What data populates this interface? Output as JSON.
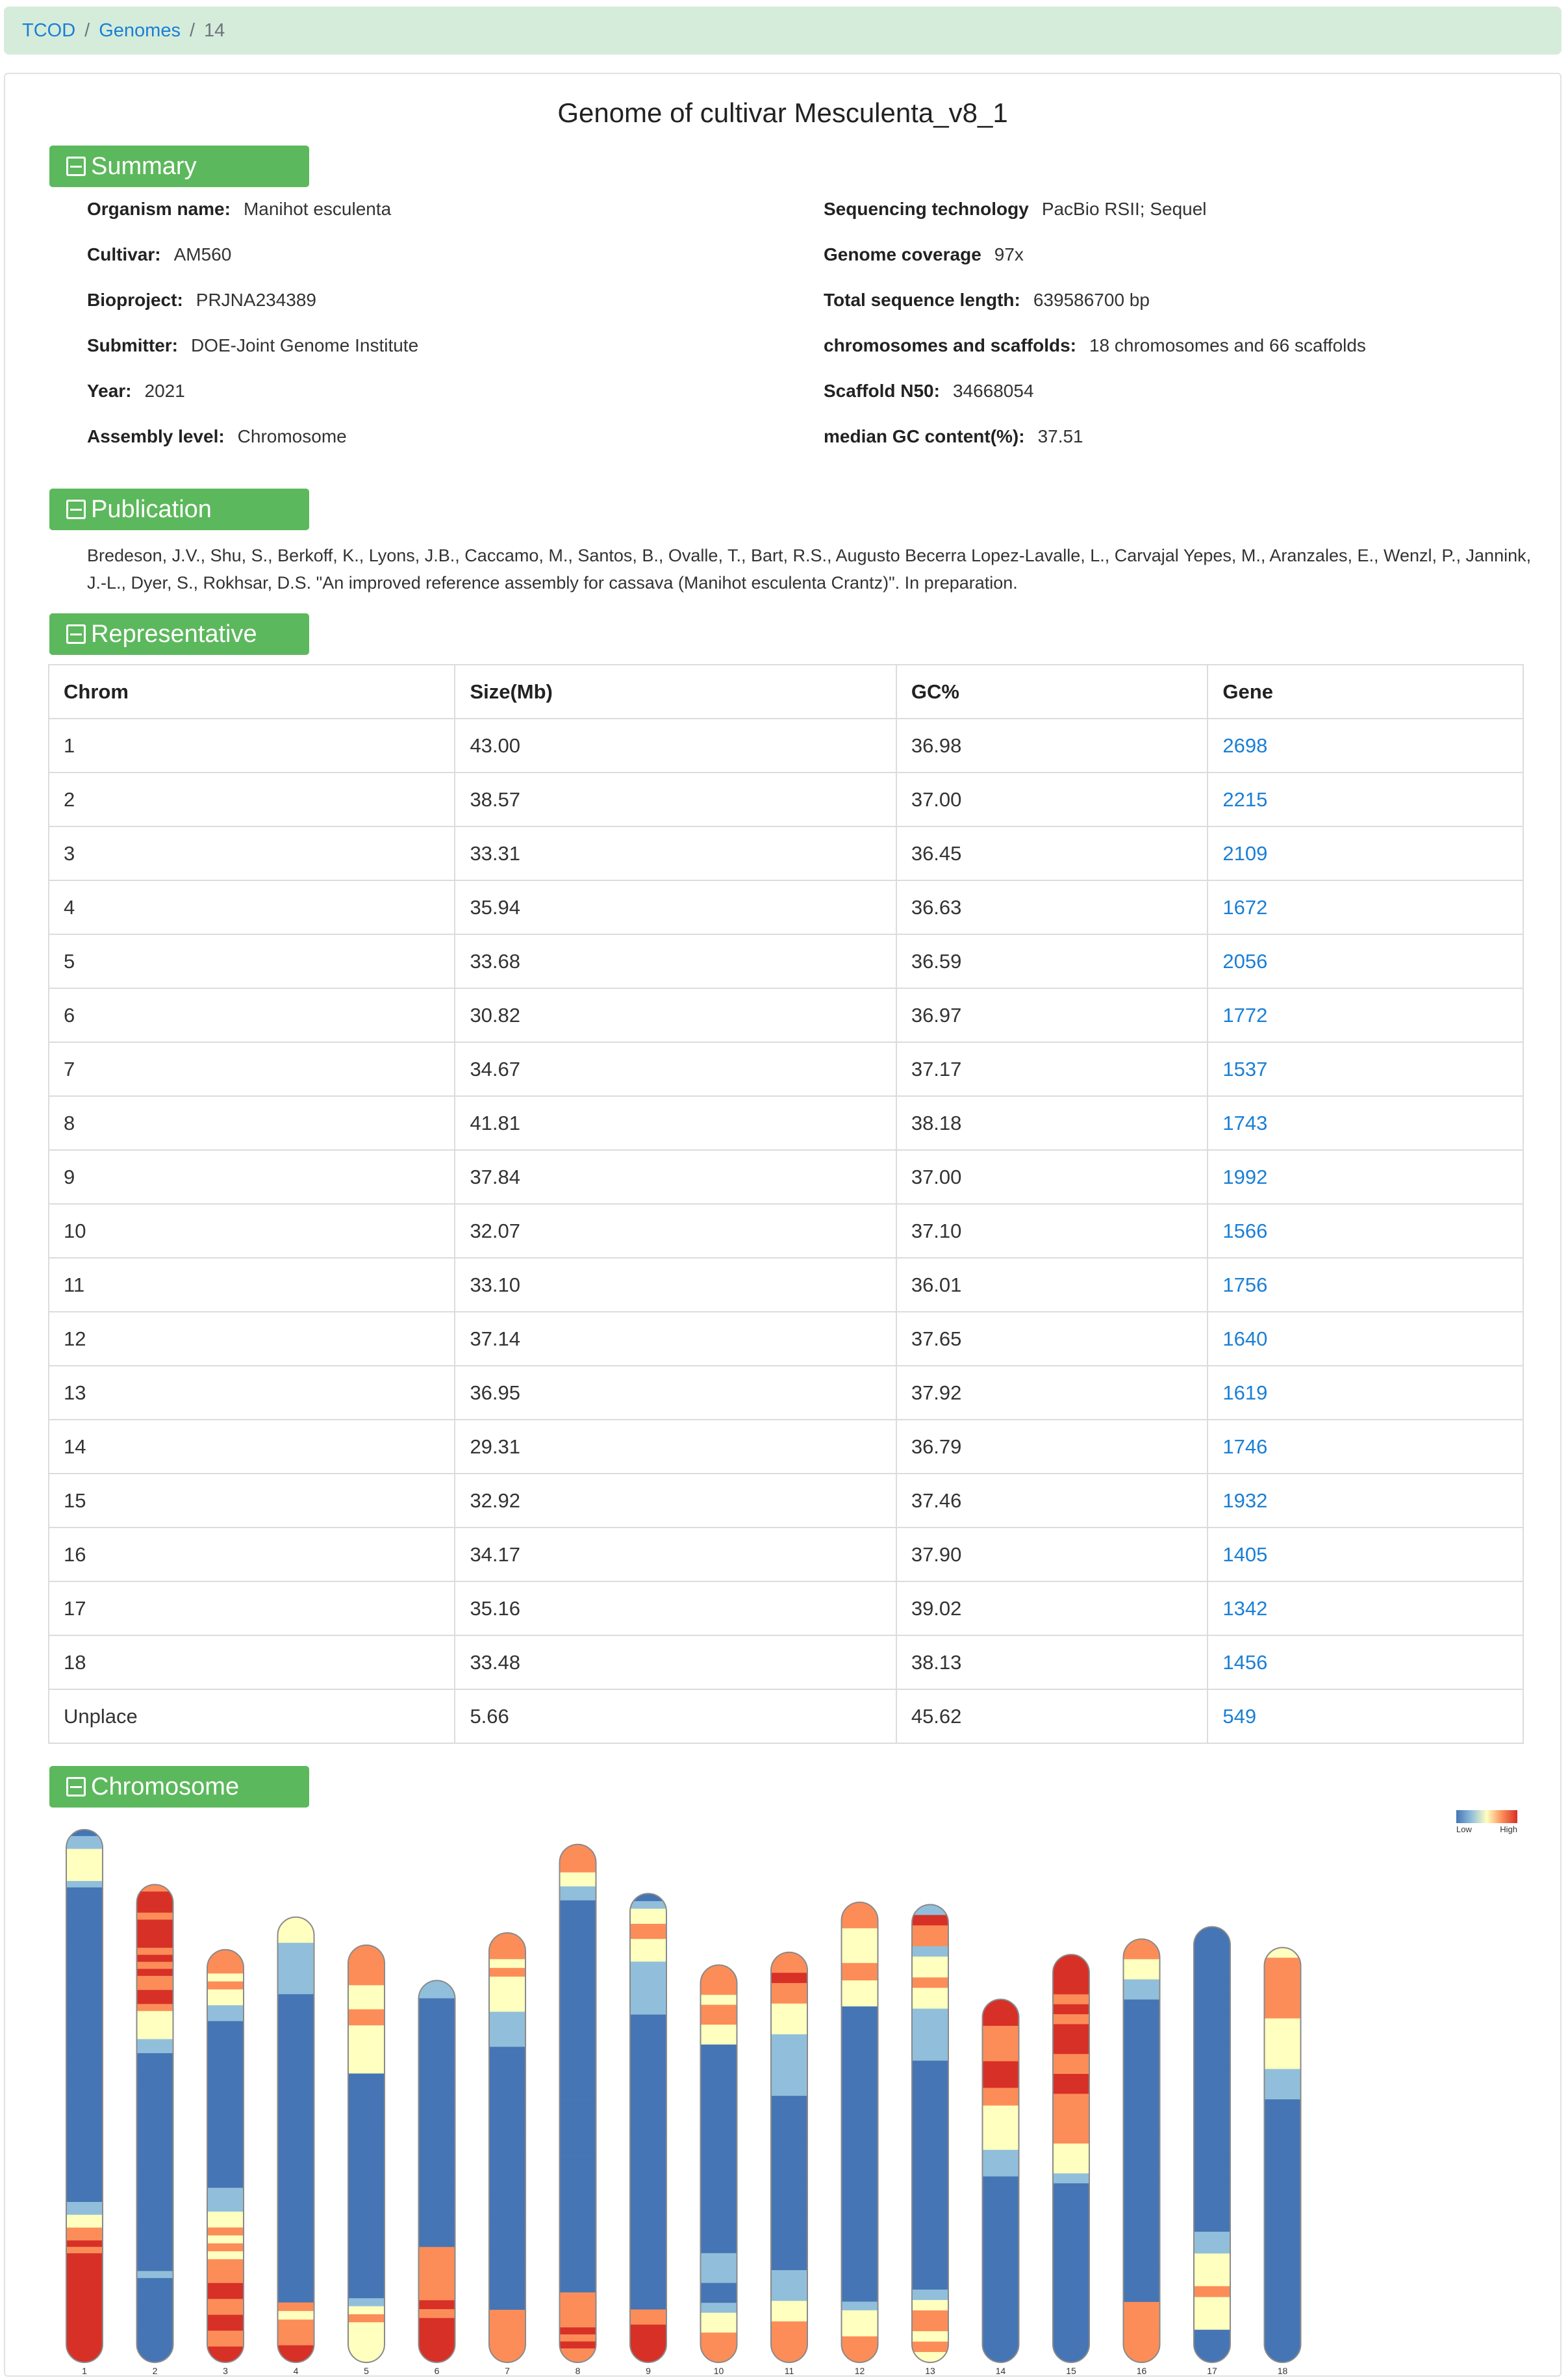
{
  "breadcrumb": {
    "home": "TCOD",
    "genomes": "Genomes",
    "current": "14"
  },
  "title": "Genome of cultivar Mesculenta_v8_1",
  "summary": {
    "heading": "Summary",
    "left": [
      {
        "label": "Organism name:",
        "value": "Manihot esculenta"
      },
      {
        "label": "Cultivar:",
        "value": "AM560"
      },
      {
        "label": "Bioproject:",
        "value": "PRJNA234389"
      },
      {
        "label": "Submitter:",
        "value": "DOE-Joint Genome Institute"
      },
      {
        "label": "Year:",
        "value": "2021"
      },
      {
        "label": "Assembly level:",
        "value": "Chromosome"
      }
    ],
    "right": [
      {
        "label": "Sequencing technology",
        "value": "PacBio RSII; Sequel"
      },
      {
        "label": "Genome coverage",
        "value": "97x"
      },
      {
        "label": "Total sequence length:",
        "value": "639586700 bp"
      },
      {
        "label": "chromosomes and scaffolds:",
        "value": "18 chromosomes and 66 scaffolds"
      },
      {
        "label": "Scaffold N50:",
        "value": "34668054"
      },
      {
        "label": "median GC content(%):",
        "value": "37.51"
      }
    ]
  },
  "publication": {
    "heading": "Publication",
    "text": "Bredeson, J.V., Shu, S., Berkoff, K., Lyons, J.B., Caccamo, M., Santos, B., Ovalle, T., Bart, R.S., Augusto Becerra Lopez-Lavalle, L., Carvajal Yepes, M., Aranzales, E., Wenzl, P., Jannink, J.-L., Dyer, S., Rokhsar, D.S. \"An improved reference assembly for cassava (Manihot esculenta Crantz)\". In preparation."
  },
  "representative": {
    "heading": "Representative",
    "columns": [
      "Chrom",
      "Size(Mb)",
      "GC%",
      "Gene"
    ],
    "rows": [
      [
        "1",
        "43.00",
        "36.98",
        "2698"
      ],
      [
        "2",
        "38.57",
        "37.00",
        "2215"
      ],
      [
        "3",
        "33.31",
        "36.45",
        "2109"
      ],
      [
        "4",
        "35.94",
        "36.63",
        "1672"
      ],
      [
        "5",
        "33.68",
        "36.59",
        "2056"
      ],
      [
        "6",
        "30.82",
        "36.97",
        "1772"
      ],
      [
        "7",
        "34.67",
        "37.17",
        "1537"
      ],
      [
        "8",
        "41.81",
        "38.18",
        "1743"
      ],
      [
        "9",
        "37.84",
        "37.00",
        "1992"
      ],
      [
        "10",
        "32.07",
        "37.10",
        "1566"
      ],
      [
        "11",
        "33.10",
        "36.01",
        "1756"
      ],
      [
        "12",
        "37.14",
        "37.65",
        "1640"
      ],
      [
        "13",
        "36.95",
        "37.92",
        "1619"
      ],
      [
        "14",
        "29.31",
        "36.79",
        "1746"
      ],
      [
        "15",
        "32.92",
        "37.46",
        "1932"
      ],
      [
        "16",
        "34.17",
        "37.90",
        "1405"
      ],
      [
        "17",
        "35.16",
        "39.02",
        "1342"
      ],
      [
        "18",
        "33.48",
        "38.13",
        "1456"
      ],
      [
        "Unplace",
        "5.66",
        "45.62",
        "549"
      ]
    ]
  },
  "chromosome": {
    "heading": "Chromosome",
    "legend": {
      "low": "Low",
      "high": "High"
    },
    "chart_data": {
      "type": "heatmap",
      "labels": [
        "1",
        "2",
        "3",
        "4",
        "5",
        "6",
        "7",
        "8",
        "9",
        "10",
        "11",
        "12",
        "13",
        "14",
        "15",
        "16",
        "17",
        "18"
      ],
      "sizes_mb": [
        43.0,
        38.57,
        33.31,
        35.94,
        33.68,
        30.82,
        34.67,
        41.81,
        37.84,
        32.07,
        33.1,
        37.14,
        36.95,
        29.31,
        32.92,
        34.17,
        35.16,
        33.48
      ],
      "density_scale": [
        "#4575b4",
        "#91bfdb",
        "#ffffbf",
        "#fc8d59",
        "#d73027"
      ],
      "density_profiles": [
        "01122222100000000000000000000000000000000000000000000000001122334344444444444444444",
        "34443444434343344322221100000000000000000000000000000001000000000000",
        "3332322110000000000000000000001112232323334433443344",
        "2221111110000000000000000000000000000000000003233344",
        "3333322233222222000000000000000000000000000012322222",
        "1100000000000000000000000000003333334344444",
        "3332322221111000000000000000000000000000000333333",
        "33332211000000000000000000000000000000000000000000000000000000003333343433",
        "01223322211111110000000000000000000000000000000000000003344444",
        "3332332200000000000000000000011100122333",
        "3343322211111100000000000000000111223333",
        "33322223322200000000000000000000000000000000001222333",
        "14331223221111100000000000000000000001233232",
        "44433334443322222111000000000000000000000",
        "44443434443344333332221000000000000000000",
        "332211000000000000000000000000000000333333",
        "0000000000000000000000000000112223222000",
        "23333332222211100000000000000000000000000"
      ]
    }
  }
}
